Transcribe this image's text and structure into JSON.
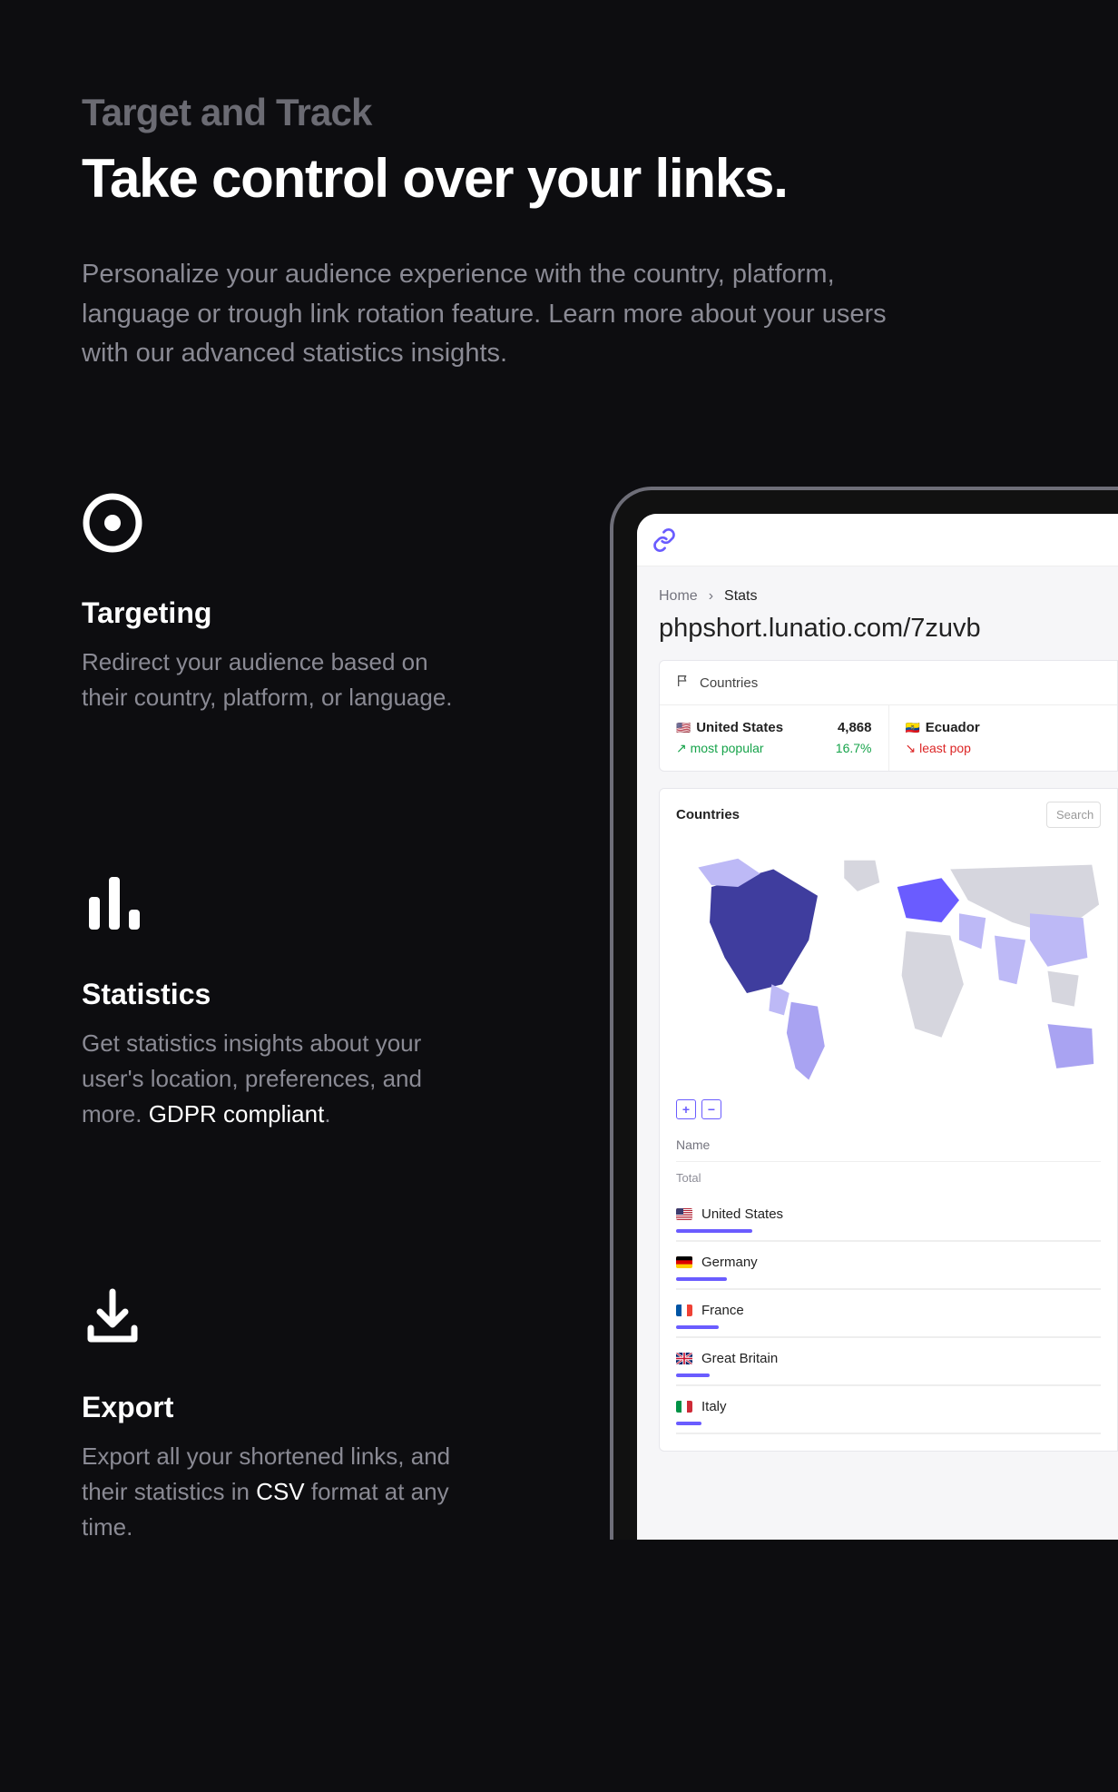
{
  "eyebrow": "Target and Track",
  "headline": "Take control over your links.",
  "subhead": "Personalize your audience experience with the country, platform, language or trough link rotation feature. Learn more about your users with our advanced statistics insights.",
  "features": {
    "targeting": {
      "title": "Targeting",
      "body": "Redirect your audience based on their country, platform, or language."
    },
    "statistics": {
      "title": "Statistics",
      "body_pre": "Get statistics insights about your user's location, preferences, and more. ",
      "body_strong": "GDPR compliant",
      "body_post": "."
    },
    "export": {
      "title": "Export",
      "body_pre": "Export all your shortened links, and their statistics in ",
      "body_strong": "CSV",
      "body_post": " format at any time."
    }
  },
  "screen": {
    "breadcrumb_home": "Home",
    "breadcrumb_sep": "›",
    "breadcrumb_current": "Stats",
    "page_url": "phpshort.lunatio.com/7zuvb",
    "countries_card_label": "Countries",
    "stat1": {
      "flag": "🇺🇸",
      "name": "United States",
      "value": "4,868",
      "trend_label": "most popular",
      "trend_value": "16.7%"
    },
    "stat2": {
      "flag": "🇪🇨",
      "name": "Ecuador",
      "trend_label": "least pop"
    },
    "countries_title": "Countries",
    "search_placeholder": "Search",
    "zoom_in": "+",
    "zoom_out": "−",
    "table_header": "Name",
    "total_label": "Total",
    "rows": [
      {
        "label": "United States",
        "bar": 18
      },
      {
        "label": "Germany",
        "bar": 12
      },
      {
        "label": "France",
        "bar": 10
      },
      {
        "label": "Great Britain",
        "bar": 8
      },
      {
        "label": "Italy",
        "bar": 6
      }
    ]
  }
}
